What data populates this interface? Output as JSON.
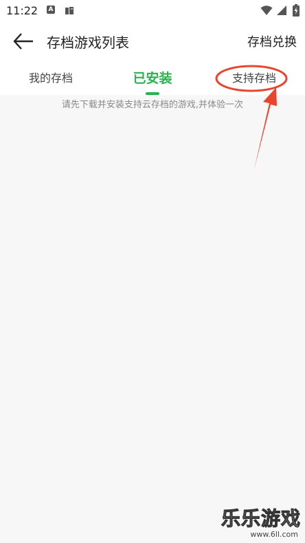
{
  "status_bar": {
    "time": "11:22",
    "notification_icons": [
      "a-badge-icon",
      "book-icon"
    ],
    "system_icons": [
      "wifi-icon",
      "signal-icon",
      "battery-charging-icon"
    ]
  },
  "app_bar": {
    "title": "存档游戏列表",
    "action_label": "存档兑换",
    "back_icon": "arrow-left-icon"
  },
  "tabs": [
    {
      "label": "我的存档",
      "active": false
    },
    {
      "label": "已安装",
      "active": true
    },
    {
      "label": "支持存档",
      "active": false
    }
  ],
  "empty_hint": "请先下载并安装支持云存档的游戏,并体验一次",
  "watermark": {
    "title": "乐乐游戏",
    "url": "www.6ll.com"
  },
  "colors": {
    "accent": "#2bb24c",
    "annotation": "#e8452c",
    "background": "#f7f7f7"
  }
}
